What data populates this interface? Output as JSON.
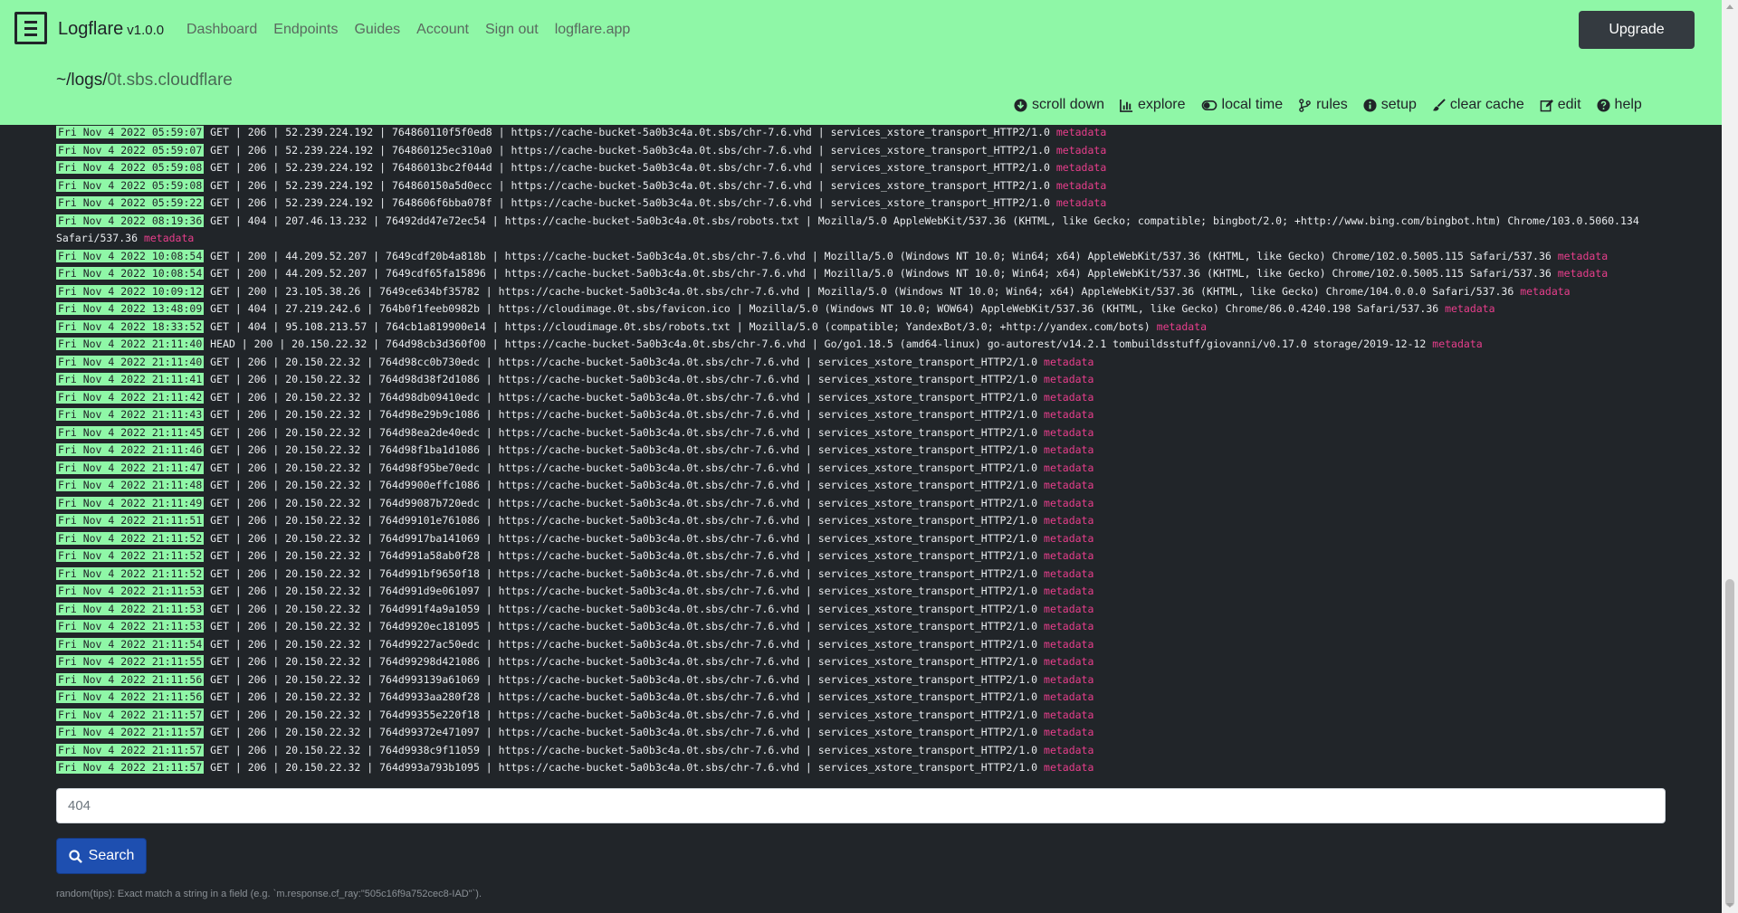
{
  "app": {
    "name": "Logflare",
    "version": "v1.0.0"
  },
  "nav": {
    "links": [
      "Dashboard",
      "Endpoints",
      "Guides",
      "Account",
      "Sign out",
      "logflare.app"
    ],
    "upgrade": "Upgrade"
  },
  "source": {
    "prefix": "~/logs/",
    "name": "0t.sbs.cloudflare"
  },
  "actions": [
    {
      "label": "scroll down",
      "icon": "arrow-circle-down-icon"
    },
    {
      "label": "explore",
      "icon": "chart-icon"
    },
    {
      "label": "local time",
      "icon": "toggle-icon"
    },
    {
      "label": "rules",
      "icon": "branch-icon"
    },
    {
      "label": "setup",
      "icon": "info-icon"
    },
    {
      "label": "clear cache",
      "icon": "brush-icon"
    },
    {
      "label": "edit",
      "icon": "edit-icon"
    },
    {
      "label": "help",
      "icon": "question-icon"
    }
  ],
  "logs": [
    {
      "ts": "Fri Nov 4 2022 05:59:07",
      "msg": " GET | 206 | 52.239.224.192 | 764860110f5f0ed8 | https://cache-bucket-5a0b3c4a.0t.sbs/chr-7.6.vhd | services_xstore_transport_HTTP2/1.0 "
    },
    {
      "ts": "Fri Nov 4 2022 05:59:07",
      "msg": " GET | 206 | 52.239.224.192 | 764860125ec310a0 | https://cache-bucket-5a0b3c4a.0t.sbs/chr-7.6.vhd | services_xstore_transport_HTTP2/1.0 "
    },
    {
      "ts": "Fri Nov 4 2022 05:59:08",
      "msg": " GET | 206 | 52.239.224.192 | 76486013bc2f044d | https://cache-bucket-5a0b3c4a.0t.sbs/chr-7.6.vhd | services_xstore_transport_HTTP2/1.0 "
    },
    {
      "ts": "Fri Nov 4 2022 05:59:08",
      "msg": " GET | 206 | 52.239.224.192 | 764860150a5d0ecc | https://cache-bucket-5a0b3c4a.0t.sbs/chr-7.6.vhd | services_xstore_transport_HTTP2/1.0 "
    },
    {
      "ts": "Fri Nov 4 2022 05:59:22",
      "msg": " GET | 206 | 52.239.224.192 | 7648606f6bba078f | https://cache-bucket-5a0b3c4a.0t.sbs/chr-7.6.vhd | services_xstore_transport_HTTP2/1.0 "
    },
    {
      "ts": "Fri Nov 4 2022 08:19:36",
      "msg": " GET | 404 | 207.46.13.232 | 76492dd47e72ec54 | https://cache-bucket-5a0b3c4a.0t.sbs/robots.txt | Mozilla/5.0 AppleWebKit/537.36 (KHTML, like Gecko; compatible; bingbot/2.0; +http://www.bing.com/bingbot.htm) Chrome/103.0.5060.134 Safari/537.36 ",
      "wrap": true
    },
    {
      "ts": "Fri Nov 4 2022 10:08:54",
      "msg": " GET | 200 | 44.209.52.207 | 7649cdf20b4a818b | https://cache-bucket-5a0b3c4a.0t.sbs/chr-7.6.vhd | Mozilla/5.0 (Windows NT 10.0; Win64; x64) AppleWebKit/537.36 (KHTML, like Gecko) Chrome/102.0.5005.115 Safari/537.36 "
    },
    {
      "ts": "Fri Nov 4 2022 10:08:54",
      "msg": " GET | 200 | 44.209.52.207 | 7649cdf65fa15896 | https://cache-bucket-5a0b3c4a.0t.sbs/chr-7.6.vhd | Mozilla/5.0 (Windows NT 10.0; Win64; x64) AppleWebKit/537.36 (KHTML, like Gecko) Chrome/102.0.5005.115 Safari/537.36 "
    },
    {
      "ts": "Fri Nov 4 2022 10:09:12",
      "msg": " GET | 200 | 23.105.38.26 | 7649ce634bf35782 | https://cache-bucket-5a0b3c4a.0t.sbs/chr-7.6.vhd | Mozilla/5.0 (Windows NT 10.0; Win64; x64) AppleWebKit/537.36 (KHTML, like Gecko) Chrome/104.0.0.0 Safari/537.36 "
    },
    {
      "ts": "Fri Nov 4 2022 13:48:09",
      "msg": " GET | 404 | 27.219.242.6 | 764b0f1feeb0982b | https://cloudimage.0t.sbs/favicon.ico | Mozilla/5.0 (Windows NT 10.0; WOW64) AppleWebKit/537.36 (KHTML, like Gecko) Chrome/86.0.4240.198 Safari/537.36 "
    },
    {
      "ts": "Fri Nov 4 2022 18:33:52",
      "msg": " GET | 404 | 95.108.213.57 | 764cb1a819900e14 | https://cloudimage.0t.sbs/robots.txt | Mozilla/5.0 (compatible; YandexBot/3.0; +http://yandex.com/bots) "
    },
    {
      "ts": "Fri Nov 4 2022 21:11:40",
      "msg": " HEAD | 200 | 20.150.22.32 | 764d98cb3d360f00 | https://cache-bucket-5a0b3c4a.0t.sbs/chr-7.6.vhd | Go/go1.18.5 (amd64-linux) go-autorest/v14.2.1 tombuildsstuff/giovanni/v0.17.0 storage/2019-12-12 "
    },
    {
      "ts": "Fri Nov 4 2022 21:11:40",
      "msg": " GET | 206 | 20.150.22.32 | 764d98cc0b730edc | https://cache-bucket-5a0b3c4a.0t.sbs/chr-7.6.vhd | services_xstore_transport_HTTP2/1.0 "
    },
    {
      "ts": "Fri Nov 4 2022 21:11:41",
      "msg": " GET | 206 | 20.150.22.32 | 764d98d38f2d1086 | https://cache-bucket-5a0b3c4a.0t.sbs/chr-7.6.vhd | services_xstore_transport_HTTP2/1.0 "
    },
    {
      "ts": "Fri Nov 4 2022 21:11:42",
      "msg": " GET | 206 | 20.150.22.32 | 764d98db09410edc | https://cache-bucket-5a0b3c4a.0t.sbs/chr-7.6.vhd | services_xstore_transport_HTTP2/1.0 "
    },
    {
      "ts": "Fri Nov 4 2022 21:11:43",
      "msg": " GET | 206 | 20.150.22.32 | 764d98e29b9c1086 | https://cache-bucket-5a0b3c4a.0t.sbs/chr-7.6.vhd | services_xstore_transport_HTTP2/1.0 "
    },
    {
      "ts": "Fri Nov 4 2022 21:11:45",
      "msg": " GET | 206 | 20.150.22.32 | 764d98ea2de40edc | https://cache-bucket-5a0b3c4a.0t.sbs/chr-7.6.vhd | services_xstore_transport_HTTP2/1.0 "
    },
    {
      "ts": "Fri Nov 4 2022 21:11:46",
      "msg": " GET | 206 | 20.150.22.32 | 764d98f1ba1d1086 | https://cache-bucket-5a0b3c4a.0t.sbs/chr-7.6.vhd | services_xstore_transport_HTTP2/1.0 "
    },
    {
      "ts": "Fri Nov 4 2022 21:11:47",
      "msg": " GET | 206 | 20.150.22.32 | 764d98f95be70edc | https://cache-bucket-5a0b3c4a.0t.sbs/chr-7.6.vhd | services_xstore_transport_HTTP2/1.0 "
    },
    {
      "ts": "Fri Nov 4 2022 21:11:48",
      "msg": " GET | 206 | 20.150.22.32 | 764d9900effc1086 | https://cache-bucket-5a0b3c4a.0t.sbs/chr-7.6.vhd | services_xstore_transport_HTTP2/1.0 "
    },
    {
      "ts": "Fri Nov 4 2022 21:11:49",
      "msg": " GET | 206 | 20.150.22.32 | 764d99087b720edc | https://cache-bucket-5a0b3c4a.0t.sbs/chr-7.6.vhd | services_xstore_transport_HTTP2/1.0 "
    },
    {
      "ts": "Fri Nov 4 2022 21:11:51",
      "msg": " GET | 206 | 20.150.22.32 | 764d99101e761086 | https://cache-bucket-5a0b3c4a.0t.sbs/chr-7.6.vhd | services_xstore_transport_HTTP2/1.0 "
    },
    {
      "ts": "Fri Nov 4 2022 21:11:52",
      "msg": " GET | 206 | 20.150.22.32 | 764d9917ba141069 | https://cache-bucket-5a0b3c4a.0t.sbs/chr-7.6.vhd | services_xstore_transport_HTTP2/1.0 "
    },
    {
      "ts": "Fri Nov 4 2022 21:11:52",
      "msg": " GET | 206 | 20.150.22.32 | 764d991a58ab0f28 | https://cache-bucket-5a0b3c4a.0t.sbs/chr-7.6.vhd | services_xstore_transport_HTTP2/1.0 "
    },
    {
      "ts": "Fri Nov 4 2022 21:11:52",
      "msg": " GET | 206 | 20.150.22.32 | 764d991bf9650f18 | https://cache-bucket-5a0b3c4a.0t.sbs/chr-7.6.vhd | services_xstore_transport_HTTP2/1.0 "
    },
    {
      "ts": "Fri Nov 4 2022 21:11:53",
      "msg": " GET | 206 | 20.150.22.32 | 764d991d9e061097 | https://cache-bucket-5a0b3c4a.0t.sbs/chr-7.6.vhd | services_xstore_transport_HTTP2/1.0 "
    },
    {
      "ts": "Fri Nov 4 2022 21:11:53",
      "msg": " GET | 206 | 20.150.22.32 | 764d991f4a9a1059 | https://cache-bucket-5a0b3c4a.0t.sbs/chr-7.6.vhd | services_xstore_transport_HTTP2/1.0 "
    },
    {
      "ts": "Fri Nov 4 2022 21:11:53",
      "msg": " GET | 206 | 20.150.22.32 | 764d9920ec181095 | https://cache-bucket-5a0b3c4a.0t.sbs/chr-7.6.vhd | services_xstore_transport_HTTP2/1.0 "
    },
    {
      "ts": "Fri Nov 4 2022 21:11:54",
      "msg": " GET | 206 | 20.150.22.32 | 764d99227ac50edc | https://cache-bucket-5a0b3c4a.0t.sbs/chr-7.6.vhd | services_xstore_transport_HTTP2/1.0 "
    },
    {
      "ts": "Fri Nov 4 2022 21:11:55",
      "msg": " GET | 206 | 20.150.22.32 | 764d99298d421086 | https://cache-bucket-5a0b3c4a.0t.sbs/chr-7.6.vhd | services_xstore_transport_HTTP2/1.0 "
    },
    {
      "ts": "Fri Nov 4 2022 21:11:56",
      "msg": " GET | 206 | 20.150.22.32 | 764d993139a61069 | https://cache-bucket-5a0b3c4a.0t.sbs/chr-7.6.vhd | services_xstore_transport_HTTP2/1.0 "
    },
    {
      "ts": "Fri Nov 4 2022 21:11:56",
      "msg": " GET | 206 | 20.150.22.32 | 764d9933aa280f28 | https://cache-bucket-5a0b3c4a.0t.sbs/chr-7.6.vhd | services_xstore_transport_HTTP2/1.0 "
    },
    {
      "ts": "Fri Nov 4 2022 21:11:57",
      "msg": " GET | 206 | 20.150.22.32 | 764d99355e220f18 | https://cache-bucket-5a0b3c4a.0t.sbs/chr-7.6.vhd | services_xstore_transport_HTTP2/1.0 "
    },
    {
      "ts": "Fri Nov 4 2022 21:11:57",
      "msg": " GET | 206 | 20.150.22.32 | 764d99372e471097 | https://cache-bucket-5a0b3c4a.0t.sbs/chr-7.6.vhd | services_xstore_transport_HTTP2/1.0 "
    },
    {
      "ts": "Fri Nov 4 2022 21:11:57",
      "msg": " GET | 206 | 20.150.22.32 | 764d9938c9f11059 | https://cache-bucket-5a0b3c4a.0t.sbs/chr-7.6.vhd | services_xstore_transport_HTTP2/1.0 "
    },
    {
      "ts": "Fri Nov 4 2022 21:11:57",
      "msg": " GET | 206 | 20.150.22.32 | 764d993a793b1095 | https://cache-bucket-5a0b3c4a.0t.sbs/chr-7.6.vhd | services_xstore_transport_HTTP2/1.0 "
    }
  ],
  "metadata_label": "metadata",
  "search": {
    "value": "404",
    "button": "Search"
  },
  "tips": "random(tips): Exact match a string in a field (e.g. `m.response.cf_ray:\"505c16f9a752cec8-IAD\"`).",
  "colors": {
    "navbar": "#8ff7a7",
    "background": "#212529",
    "metadata": "#e83e8c",
    "search_button": "#1e4fb0"
  }
}
